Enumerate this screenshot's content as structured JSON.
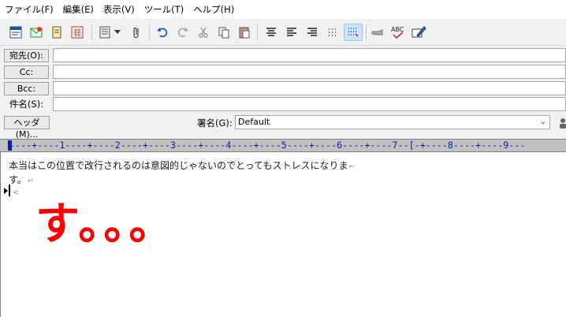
{
  "menu": {
    "items": [
      "ファイル(F)",
      "編集(E)",
      "表示(V)",
      "ツール(T)",
      "ヘルプ(H)"
    ]
  },
  "toolbar": {
    "icons": [
      "address-book-icon",
      "check-mail-icon",
      "notepad-icon",
      "calendar-icon",
      "template-icon",
      "dropdown-arrow-icon",
      "attach-icon",
      "undo-icon",
      "redo-icon",
      "cut-icon",
      "copy-icon",
      "paste-icon",
      "align-center-icon",
      "align-left-icon",
      "align-right-icon",
      "show-marks-icon",
      "format-icon",
      "pointing-hand-icon",
      "spell-check-icon",
      "signature-pen-icon"
    ]
  },
  "header": {
    "to_label": "宛先(O):",
    "cc_label": "Cc:",
    "bcc_label": "Bcc:",
    "subject_label": "件名(S):",
    "header_button": "ヘッダ(M)...",
    "signature_label": "署名(G):",
    "signature_value": "Default"
  },
  "ruler": {
    "text": "----+----1----+----2----+----3----+----4----+----5----+----6----+----7--[-+----8----+----9---"
  },
  "editor": {
    "line1": "本当はこの位置で改行されるのは意図的じゃないのでとってもストレスになりま",
    "line2": "す。",
    "soft_break_mark": "←",
    "hard_break_mark": "↵",
    "eof_mark": "<"
  },
  "overlay": {
    "text": "す。。。"
  },
  "colors": {
    "overlay_red": "#ff0000",
    "ruler_blue": "#1020a0"
  }
}
